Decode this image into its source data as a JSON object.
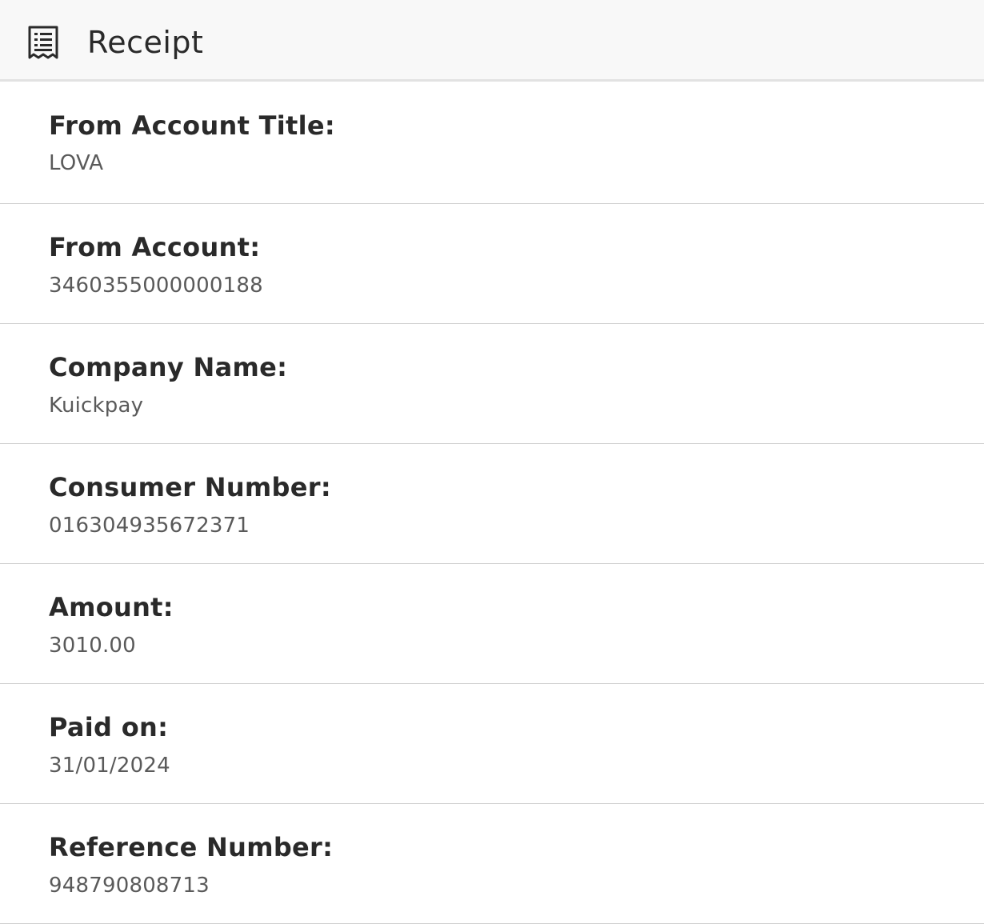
{
  "header": {
    "title": "Receipt",
    "icon": "receipt-icon"
  },
  "fields": [
    {
      "label": "From Account Title:",
      "value": "LOVA"
    },
    {
      "label": "From Account:",
      "value": "3460355000000188"
    },
    {
      "label": "Company Name:",
      "value": "Kuickpay"
    },
    {
      "label": "Consumer Number:",
      "value": "016304935672371"
    },
    {
      "label": "Amount:",
      "value": "3010.00"
    },
    {
      "label": "Paid on:",
      "value": "31/01/2024"
    },
    {
      "label": "Reference Number:",
      "value": "948790808713"
    }
  ]
}
